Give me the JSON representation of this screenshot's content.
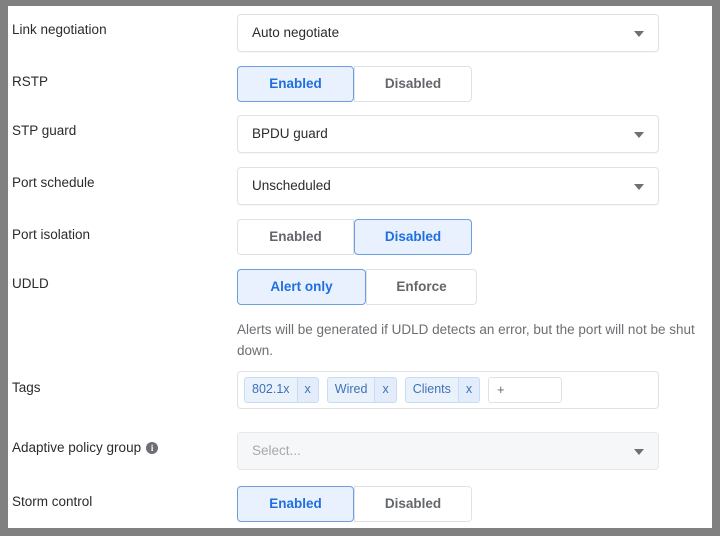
{
  "window": {
    "frame_color": "#808080",
    "content_background": "#ffffff"
  },
  "theme": {
    "accent_blue": "#1f6fe0",
    "selected_fill": "#e8f1fd",
    "selected_border": "#6aa0dd",
    "chip_fill": "#e9f1fb",
    "chip_text": "#4071b8",
    "label_text": "#2b2b2b",
    "muted_text": "#6b6e72"
  },
  "form": {
    "rows": [
      {
        "label": "Link negotiation",
        "type": "select",
        "value": "Auto negotiate",
        "muted": false
      },
      {
        "label": "RSTP",
        "type": "segmented",
        "options": [
          "Enabled",
          "Disabled"
        ],
        "selected": "Enabled"
      },
      {
        "label": "STP guard",
        "type": "select",
        "value": "BPDU guard",
        "muted": false
      },
      {
        "label": "Port schedule",
        "type": "select",
        "value": "Unscheduled",
        "muted": false
      },
      {
        "label": "Port isolation",
        "type": "segmented",
        "options": [
          "Enabled",
          "Disabled"
        ],
        "selected": "Disabled"
      },
      {
        "label": "UDLD",
        "type": "segmented",
        "options": [
          "Alert only",
          "Enforce"
        ],
        "selected": "Alert only",
        "help": "Alerts will be generated if UDLD detects an error, but the port will not be shut down."
      },
      {
        "label": "Tags",
        "type": "tags",
        "chips": [
          {
            "text": "802.1x",
            "remove": "x"
          },
          {
            "text": "Wired",
            "remove": "x"
          },
          {
            "text": "Clients",
            "remove": "x"
          }
        ],
        "add_placeholder": "+"
      },
      {
        "label": "Adaptive policy group",
        "has_info_icon": true,
        "info_icon_glyph": "i",
        "type": "select",
        "value": "Select...",
        "muted": true
      },
      {
        "label": "Storm control",
        "type": "segmented",
        "options": [
          "Enabled",
          "Disabled"
        ],
        "selected": "Enabled"
      }
    ]
  }
}
